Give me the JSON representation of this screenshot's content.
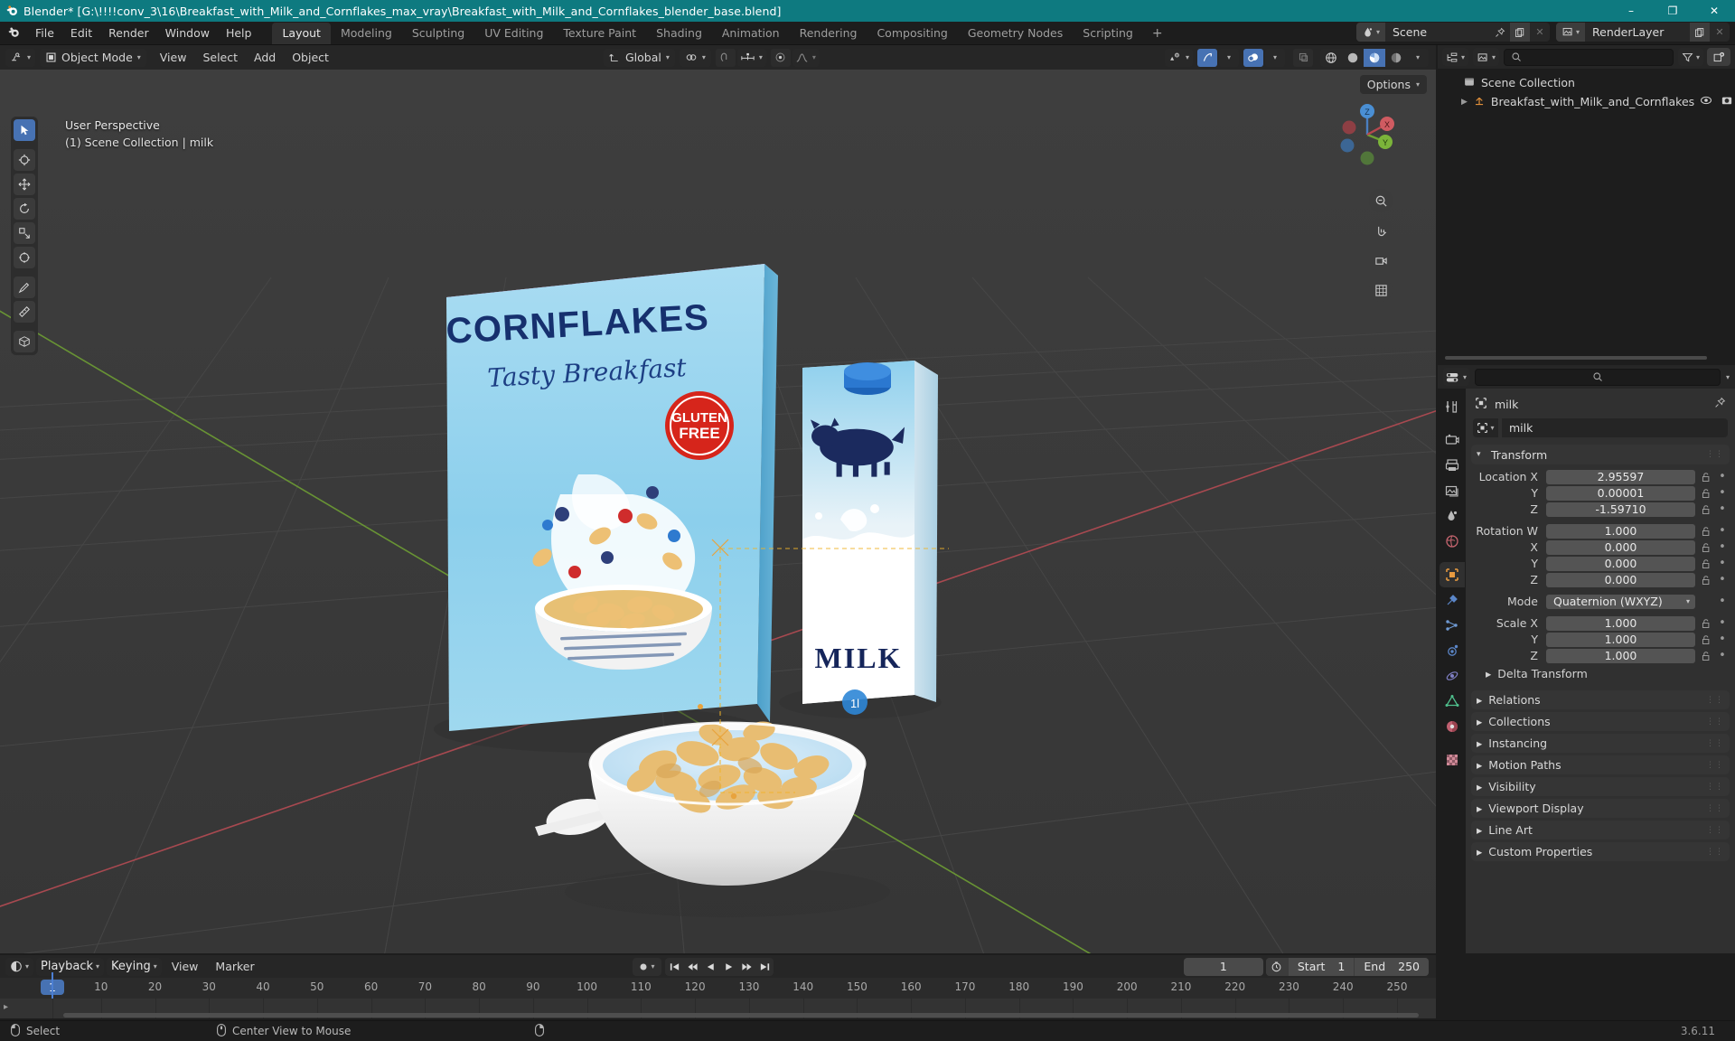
{
  "window": {
    "title": "Blender* [G:\\!!!!conv_3\\16\\Breakfast_with_Milk_and_Cornflakes_max_vray\\Breakfast_with_Milk_and_Cornflakes_blender_base.blend]",
    "minimize": "–",
    "maximize": "❐",
    "close": "✕"
  },
  "topbar": {
    "menus": [
      "File",
      "Edit",
      "Render",
      "Window",
      "Help"
    ],
    "workspaces": [
      {
        "label": "Layout",
        "active": true
      },
      {
        "label": "Modeling",
        "active": false
      },
      {
        "label": "Sculpting",
        "active": false
      },
      {
        "label": "UV Editing",
        "active": false
      },
      {
        "label": "Texture Paint",
        "active": false
      },
      {
        "label": "Shading",
        "active": false
      },
      {
        "label": "Animation",
        "active": false
      },
      {
        "label": "Rendering",
        "active": false
      },
      {
        "label": "Compositing",
        "active": false
      },
      {
        "label": "Geometry Nodes",
        "active": false
      },
      {
        "label": "Scripting",
        "active": false
      }
    ],
    "add_workspace": "+",
    "scene_name": "Scene",
    "view_layer_name": "RenderLayer"
  },
  "viewport": {
    "mode": "Object Mode",
    "menus": [
      "View",
      "Select",
      "Add",
      "Object"
    ],
    "transform_orientation": "Global",
    "options_label": "Options",
    "overlay_line1": "User Perspective",
    "overlay_line2": "(1) Scene Collection | milk",
    "gizmo_axes": {
      "x": "X",
      "y": "Y",
      "z": "Z"
    },
    "tools": [
      "tweak-select-tool",
      "cursor-tool",
      "move-tool",
      "rotate-tool",
      "scale-tool",
      "transform-tool",
      "annotate-tool",
      "measure-tool",
      "add-cube-tool"
    ]
  },
  "outliner": {
    "search_placeholder": "",
    "rows": [
      {
        "label": "Scene Collection",
        "depth": 0,
        "icon": "collection-icon",
        "expandable": false
      },
      {
        "label": "Breakfast_with_Milk_and_Cornflakes",
        "depth": 1,
        "icon": "empty-axes-icon",
        "expandable": true
      }
    ]
  },
  "properties": {
    "breadcrumb_object": "milk",
    "object_name": "milk",
    "transform": {
      "title": "Transform",
      "rows": [
        {
          "label": "Location X",
          "value": "2.95597",
          "type": "number"
        },
        {
          "label": "Y",
          "value": "0.00001",
          "type": "number"
        },
        {
          "label": "Z",
          "value": "-1.59710",
          "type": "number"
        },
        {
          "label": "Rotation W",
          "value": "1.000",
          "type": "number",
          "gap": true
        },
        {
          "label": "X",
          "value": "0.000",
          "type": "number"
        },
        {
          "label": "Y",
          "value": "0.000",
          "type": "number"
        },
        {
          "label": "Z",
          "value": "0.000",
          "type": "number"
        },
        {
          "label": "Mode",
          "value": "Quaternion (WXYZ)",
          "type": "select",
          "gap": true
        },
        {
          "label": "Scale X",
          "value": "1.000",
          "type": "number",
          "gap": true
        },
        {
          "label": "Y",
          "value": "1.000",
          "type": "number"
        },
        {
          "label": "Z",
          "value": "1.000",
          "type": "number"
        }
      ],
      "subpanel": "Delta Transform"
    },
    "closed_panels": [
      "Relations",
      "Collections",
      "Instancing",
      "Motion Paths",
      "Visibility",
      "Viewport Display",
      "Line Art",
      "Custom Properties"
    ],
    "tabs": [
      "tool-tab",
      "render-tab",
      "output-tab",
      "view-layer-tab",
      "scene-tab",
      "world-tab",
      "object-tab",
      "modifiers-tab",
      "particles-tab",
      "physics-tab",
      "constraints-tab",
      "data-tab",
      "material-tab",
      "texture-tab"
    ]
  },
  "timeline": {
    "menus": [
      "Playback",
      "Keying",
      "View",
      "Marker"
    ],
    "current_frame": "1",
    "start_label": "Start",
    "start_value": "1",
    "end_label": "End",
    "end_value": "250",
    "ticks": [
      1,
      10,
      20,
      30,
      40,
      50,
      60,
      70,
      80,
      90,
      100,
      110,
      120,
      130,
      140,
      150,
      160,
      170,
      180,
      190,
      200,
      210,
      220,
      230,
      240,
      250
    ],
    "playhead_frame": 1
  },
  "statusbar": {
    "items": [
      {
        "icon": "mouse-left-icon",
        "label": "Select"
      },
      {
        "icon": "mouse-middle-icon",
        "label": "Center View to Mouse"
      },
      {
        "icon": "mouse-right-icon",
        "label": ""
      }
    ],
    "version": "3.6.11"
  },
  "scene_objects": {
    "cereal_box": {
      "title": "CORNFLAKES",
      "subtitle": "Tasty Breakfast",
      "badge_line1": "GLUTEN",
      "badge_line2": "FREE"
    },
    "milk_carton": {
      "label": "MILK"
    },
    "bowl": {
      "label": ""
    }
  },
  "colors": {
    "title_bar": "#0e7a80",
    "accent_blue": "#4772b3",
    "viewport_bg": "#393939",
    "panel_bg": "#303030",
    "header_bg": "#262626",
    "axis_x_red": "#c94a50",
    "axis_y_green": "#6ca72f",
    "box_blue": "#74c3e8",
    "box_title_navy": "#1a3a78",
    "badge_red": "#d9281e"
  }
}
